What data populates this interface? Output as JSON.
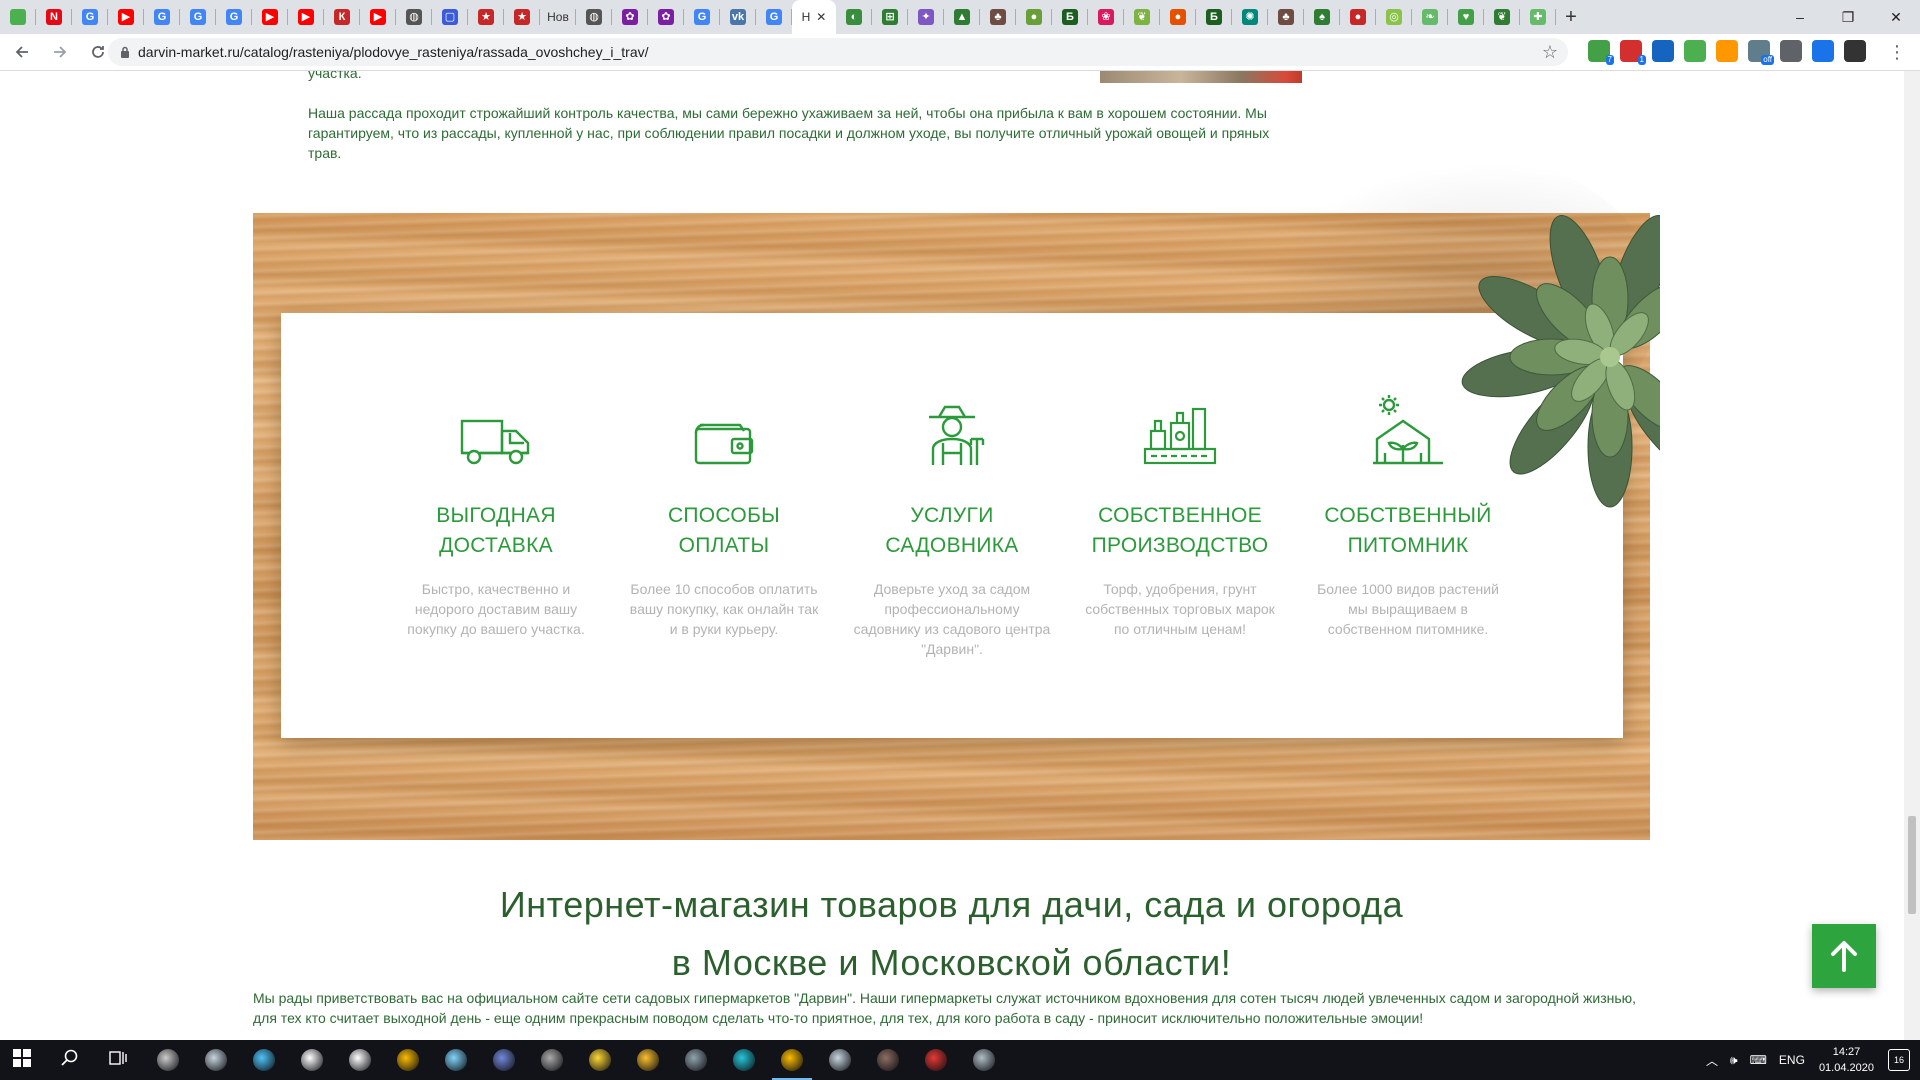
{
  "browser": {
    "tabs": [
      {
        "icon": "leaf-icon",
        "color": "#4caf50",
        "glyph": ""
      },
      {
        "icon": "netflix-icon",
        "color": "#e50914",
        "glyph": "N"
      },
      {
        "icon": "google-icon",
        "color": "#4285f4",
        "glyph": "G"
      },
      {
        "icon": "youtube-icon",
        "color": "#ff0000",
        "glyph": "▶"
      },
      {
        "icon": "google-icon",
        "color": "#4285f4",
        "glyph": "G"
      },
      {
        "icon": "google-icon",
        "color": "#4285f4",
        "glyph": "G"
      },
      {
        "icon": "google-icon",
        "color": "#4285f4",
        "glyph": "G"
      },
      {
        "icon": "youtube-icon",
        "color": "#ff0000",
        "glyph": "▶"
      },
      {
        "icon": "youtube-icon",
        "color": "#ff0000",
        "glyph": "▶"
      },
      {
        "icon": "bookmark-icon",
        "color": "#c62828",
        "glyph": "К"
      },
      {
        "icon": "youtube-icon",
        "color": "#ff0000",
        "glyph": "▶"
      },
      {
        "icon": "globe-icon",
        "color": "#555555",
        "glyph": "◍"
      },
      {
        "icon": "chat-icon",
        "color": "#3b5bdb",
        "glyph": "▢"
      },
      {
        "icon": "star-badge-icon",
        "color": "#c62828",
        "glyph": "★"
      },
      {
        "icon": "star-badge-icon",
        "color": "#c62828",
        "glyph": "★"
      },
      {
        "icon": "text-tab",
        "color": "",
        "glyph": "",
        "text": "Нов"
      },
      {
        "icon": "globe-icon",
        "color": "#555555",
        "glyph": "◍"
      },
      {
        "icon": "flower-icon",
        "color": "#7b1fa2",
        "glyph": "✿"
      },
      {
        "icon": "flower-icon",
        "color": "#7b1fa2",
        "glyph": "✿"
      },
      {
        "icon": "google-icon",
        "color": "#4285f4",
        "glyph": "G"
      },
      {
        "icon": "vk-icon",
        "color": "#4a76a8",
        "glyph": "vk"
      },
      {
        "icon": "google-icon",
        "color": "#4285f4",
        "glyph": "G"
      }
    ],
    "active_tab": {
      "label": "Н"
    },
    "tabs_after": [
      {
        "icon": "leaf-icon",
        "color": "#388e3c",
        "glyph": "◐"
      },
      {
        "icon": "box-icon",
        "color": "#2e7d32",
        "glyph": "⊞"
      },
      {
        "icon": "sparkle-icon",
        "color": "#7e57c2",
        "glyph": "✦"
      },
      {
        "icon": "mountain-icon",
        "color": "#2e7d32",
        "glyph": "▲"
      },
      {
        "icon": "plant-icon",
        "color": "#6d4c41",
        "glyph": "♣"
      },
      {
        "icon": "apple-icon",
        "color": "#689f38",
        "glyph": "●"
      },
      {
        "icon": "b-icon",
        "color": "#1b5e20",
        "glyph": "Б"
      },
      {
        "icon": "flower-icon",
        "color": "#d81b60",
        "glyph": "❀"
      },
      {
        "icon": "sprout-icon",
        "color": "#7cb342",
        "glyph": "❦"
      },
      {
        "icon": "apple-icon",
        "color": "#e65100",
        "glyph": "●"
      },
      {
        "icon": "b-icon",
        "color": "#1b5e20",
        "glyph": "Б"
      },
      {
        "icon": "tree-icon",
        "color": "#00897b",
        "glyph": "✺"
      },
      {
        "icon": "plant-icon",
        "color": "#6d4c41",
        "glyph": "♣"
      },
      {
        "icon": "tree-icon",
        "color": "#2e7d32",
        "glyph": "♠"
      },
      {
        "icon": "tomato-icon",
        "color": "#c62828",
        "glyph": "●"
      },
      {
        "icon": "spiral-icon",
        "color": "#8bc34a",
        "glyph": "◎"
      },
      {
        "icon": "leaf-icon",
        "color": "#66bb6a",
        "glyph": "❧"
      },
      {
        "icon": "heart-leaf-icon",
        "color": "#43a047",
        "glyph": "♥"
      },
      {
        "icon": "leaf-icon",
        "color": "#2e7d32",
        "glyph": "❦"
      },
      {
        "icon": "plus-leaf-icon",
        "color": "#66bb6a",
        "glyph": "✚"
      }
    ],
    "new_tab_label": "+",
    "window_controls": {
      "minimize": "–",
      "maximize": "❐",
      "close": "✕"
    },
    "url": "darvin-market.ru/catalog/rasteniya/plodovye_rasteniya/rassada_ovoshchey_i_trav/",
    "extensions": [
      {
        "icon": "puzzle-icon",
        "color": "#43a047",
        "badge": "7"
      },
      {
        "icon": "adblock-icon",
        "color": "#d32f2f",
        "badge": "1"
      },
      {
        "icon": "shield-icon",
        "color": "#1565c0",
        "badge": ""
      },
      {
        "icon": "ed-icon",
        "color": "#4caf50",
        "badge": ""
      },
      {
        "icon": "fox-icon",
        "color": "#ff9800",
        "badge": ""
      },
      {
        "icon": "vpn-icon",
        "color": "#607d8b",
        "badge": "off"
      },
      {
        "icon": "download-icon",
        "color": "#5f6368",
        "badge": ""
      },
      {
        "icon": "translate-icon",
        "color": "#1a73e8",
        "badge": ""
      },
      {
        "icon": "avatar-icon",
        "color": "#333333",
        "badge": ""
      }
    ]
  },
  "page": {
    "cut_text": "участка.",
    "intro_text": "Наша рассада проходит строжайший контроль качества, мы сами бережно ухаживаем за ней, чтобы она прибыла к вам в хорошем состоянии. Мы гарантируем, что из рассады, купленной у нас, при соблюдении правил посадки и должном уходе, вы получите отличный урожай овощей и пряных трав.",
    "features": [
      {
        "icon": "truck-icon",
        "title": "ВЫГОДНАЯ ДОСТАВКА",
        "desc": "Быстро, качественно и недорого доставим вашу покупку до вашего участка."
      },
      {
        "icon": "wallet-icon",
        "title": "СПОСОБЫ ОПЛАТЫ",
        "desc": "Более 10 способов оплатить вашу покупку, как онлайн так и в руки курьеру."
      },
      {
        "icon": "gardener-icon",
        "title": "УСЛУГИ САДОВНИКА",
        "desc": "Доверьте уход за садом профессиональному садовнику из садового центра \"Дарвин\"."
      },
      {
        "icon": "factory-icon",
        "title": "СОБСТВЕННОЕ ПРОИЗВОДСТВО",
        "desc": "Торф, удобрения, грунт собственных торговых марок по отличным ценам!"
      },
      {
        "icon": "greenhouse-icon",
        "title": "СОБСТВЕННЫЙ ПИТОМНИК",
        "desc": "Более 1000 видов растений мы выращиваем в собственном питомнике."
      }
    ],
    "heading_line1": "Интернет-магазин товаров для дачи, сада и огорода",
    "heading_line2": "в Москве и Московской области!",
    "welcome_text": "Мы рады приветствовать вас на официальном сайте сети садовых гипермаркетов \"Дарвин\". Наши гипермаркеты служат источником вдохновения для сотен тысяч людей увлеченных садом и загородной жизнью, для тех кто считает выходной день - еще одним прекрасным поводом сделать что-то приятное, для тех, для кого работа в саду - приносит исключительно положительные эмоции!",
    "accent_color": "#2b9a3a"
  },
  "taskbar": {
    "apps": [
      {
        "icon": "windows-start-icon",
        "color": "#ffffff"
      },
      {
        "icon": "search-icon",
        "color": "#ffffff"
      },
      {
        "icon": "task-view-icon",
        "color": "#ffffff"
      },
      {
        "icon": "obs-icon",
        "color": "#cccccc"
      },
      {
        "icon": "steam-icon",
        "color": "#c7d5e0"
      },
      {
        "icon": "window-app-icon",
        "color": "#4fc3f7"
      },
      {
        "icon": "drive-icon",
        "color": "#ffffff"
      },
      {
        "icon": "file-icon",
        "color": "#ffffff"
      },
      {
        "icon": "chrome-icon",
        "color": "#fbbc04"
      },
      {
        "icon": "app-icon",
        "color": "#81d4fa"
      },
      {
        "icon": "discord-icon",
        "color": "#7289da"
      },
      {
        "icon": "video-editor-icon",
        "color": "#aaaaaa"
      },
      {
        "icon": "triangle-app-icon",
        "color": "#fdd835"
      },
      {
        "icon": "folder-icon",
        "color": "#fbc02d"
      },
      {
        "icon": "image-viewer-icon",
        "color": "#90a4ae"
      },
      {
        "icon": "vpn-shield-icon",
        "color": "#26c6da"
      },
      {
        "icon": "chrome-icon",
        "color": "#fbbc04",
        "active": true
      },
      {
        "icon": "steam-icon",
        "color": "#c7d5e0"
      },
      {
        "icon": "horse-app-icon",
        "color": "#8d6e63"
      },
      {
        "icon": "media-player-icon",
        "color": "#e53935"
      },
      {
        "icon": "paint-icon",
        "color": "#b0bec5"
      }
    ],
    "lang": "ENG",
    "time": "14:27",
    "date": "01.04.2020",
    "notifications": "16"
  }
}
